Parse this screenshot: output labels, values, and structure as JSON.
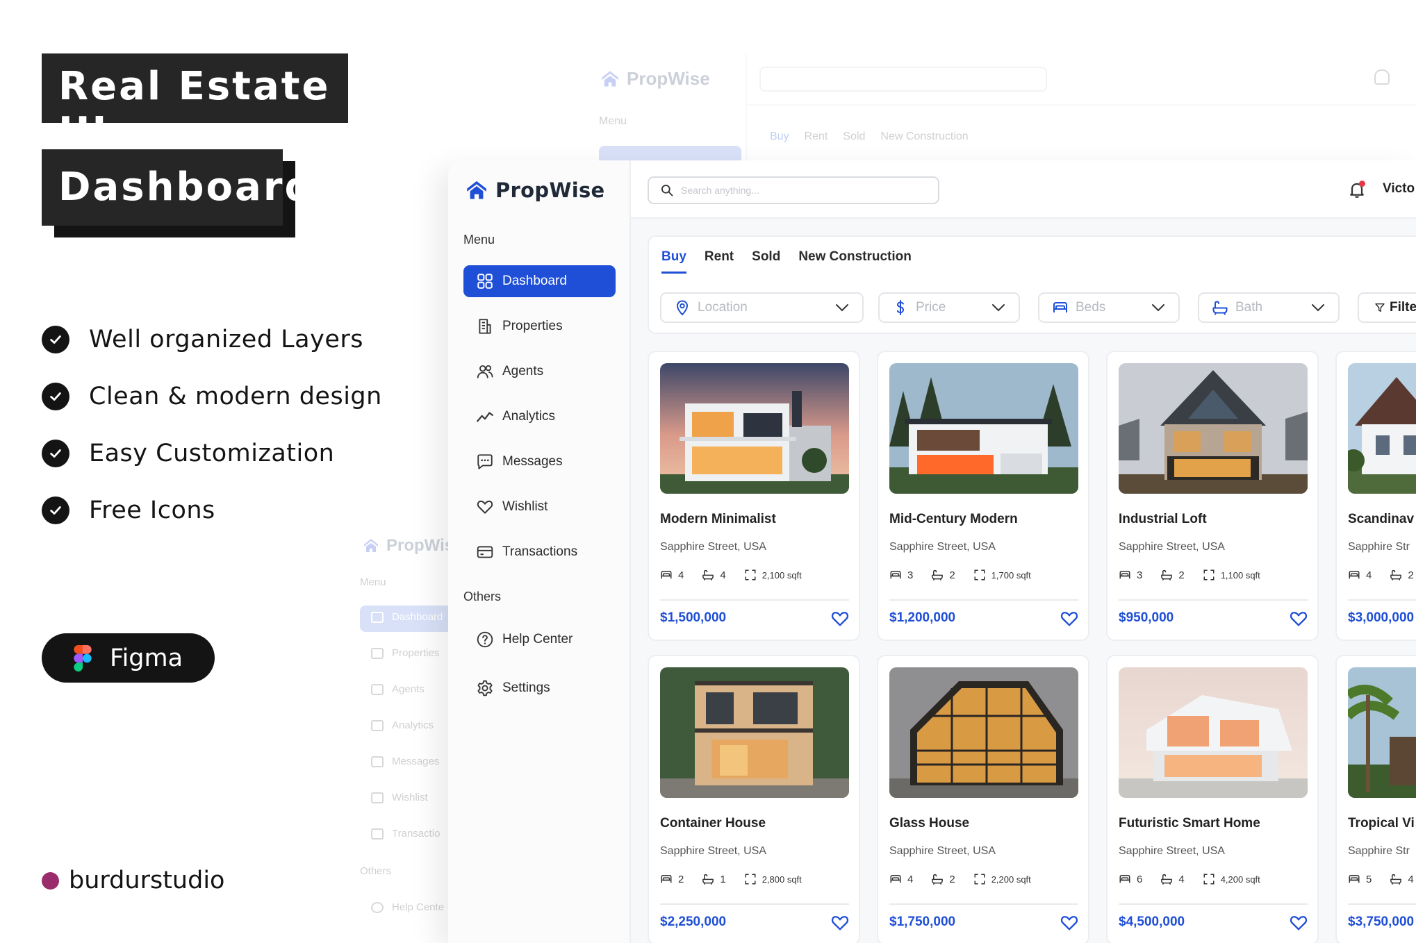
{
  "promo": {
    "title_line1": "Real Estate UI",
    "title_line2": "Dashboard",
    "features": [
      "Well organized Layers",
      "Clean & modern design",
      "Easy Customization",
      "Free Icons"
    ],
    "figma_label": "Figma",
    "studio": "burdurstudio"
  },
  "app": {
    "brand": "PropWise",
    "search_placeholder": "Search anything...",
    "user_name": "Victo",
    "colors": {
      "accent": "#1f4fd6",
      "badge": "#e63946",
      "studio_dot": "#9b2c6c"
    }
  },
  "sidebar": {
    "menu_label": "Menu",
    "items": [
      {
        "label": "Dashboard",
        "icon": "grid-icon"
      },
      {
        "label": "Properties",
        "icon": "document-icon"
      },
      {
        "label": "Agents",
        "icon": "users-icon"
      },
      {
        "label": "Analytics",
        "icon": "trend-icon"
      },
      {
        "label": "Messages",
        "icon": "chat-icon"
      },
      {
        "label": "Wishlist",
        "icon": "heart-icon"
      },
      {
        "label": "Transactions",
        "icon": "card-icon"
      }
    ],
    "others_label": "Others",
    "others": [
      {
        "label": "Help Center",
        "icon": "help-icon"
      },
      {
        "label": "Settings",
        "icon": "gear-icon"
      }
    ]
  },
  "filters": {
    "tabs": [
      "Buy",
      "Rent",
      "Sold",
      "New Construction"
    ],
    "active_tab": "Buy",
    "location": "Location",
    "price": "Price",
    "beds": "Beds",
    "bath": "Bath",
    "more": "Filte"
  },
  "properties": [
    {
      "name": "Modern Minimalist",
      "address": "Sapphire Street, USA",
      "beds": "4",
      "baths": "4",
      "area": "2,100 sqft",
      "price": "$1,500,000"
    },
    {
      "name": "Mid-Century Modern",
      "address": "Sapphire Street, USA",
      "beds": "3",
      "baths": "2",
      "area": "1,700 sqft",
      "price": "$1,200,000"
    },
    {
      "name": "Industrial Loft",
      "address": "Sapphire Street, USA",
      "beds": "3",
      "baths": "2",
      "area": "1,100 sqft",
      "price": "$950,000"
    },
    {
      "name": "Scandinav",
      "address": "Sapphire Str",
      "beds": "4",
      "baths": "2",
      "area": "",
      "price": "$3,000,000"
    },
    {
      "name": "Container House",
      "address": "Sapphire Street, USA",
      "beds": "2",
      "baths": "1",
      "area": "2,800 sqft",
      "price": "$2,250,000"
    },
    {
      "name": "Glass House",
      "address": "Sapphire Street, USA",
      "beds": "4",
      "baths": "2",
      "area": "2,200 sqft",
      "price": "$1,750,000"
    },
    {
      "name": "Futuristic Smart Home",
      "address": "Sapphire Street, USA",
      "beds": "6",
      "baths": "4",
      "area": "4,200 sqft",
      "price": "$4,500,000"
    },
    {
      "name": "Tropical Vi",
      "address": "Sapphire Str",
      "beds": "5",
      "baths": "4",
      "area": "",
      "price": "$3,750,000"
    }
  ],
  "ghost": {
    "tabs": [
      "Buy",
      "Rent",
      "Sold",
      "New Construction"
    ],
    "menu_label": "Menu",
    "dashboard": "Dashboard",
    "items": [
      "Properties",
      "Agents",
      "Analytics",
      "Messages",
      "Wishlist",
      "Transactio"
    ],
    "others_label": "Others",
    "help": "Help Cente"
  }
}
